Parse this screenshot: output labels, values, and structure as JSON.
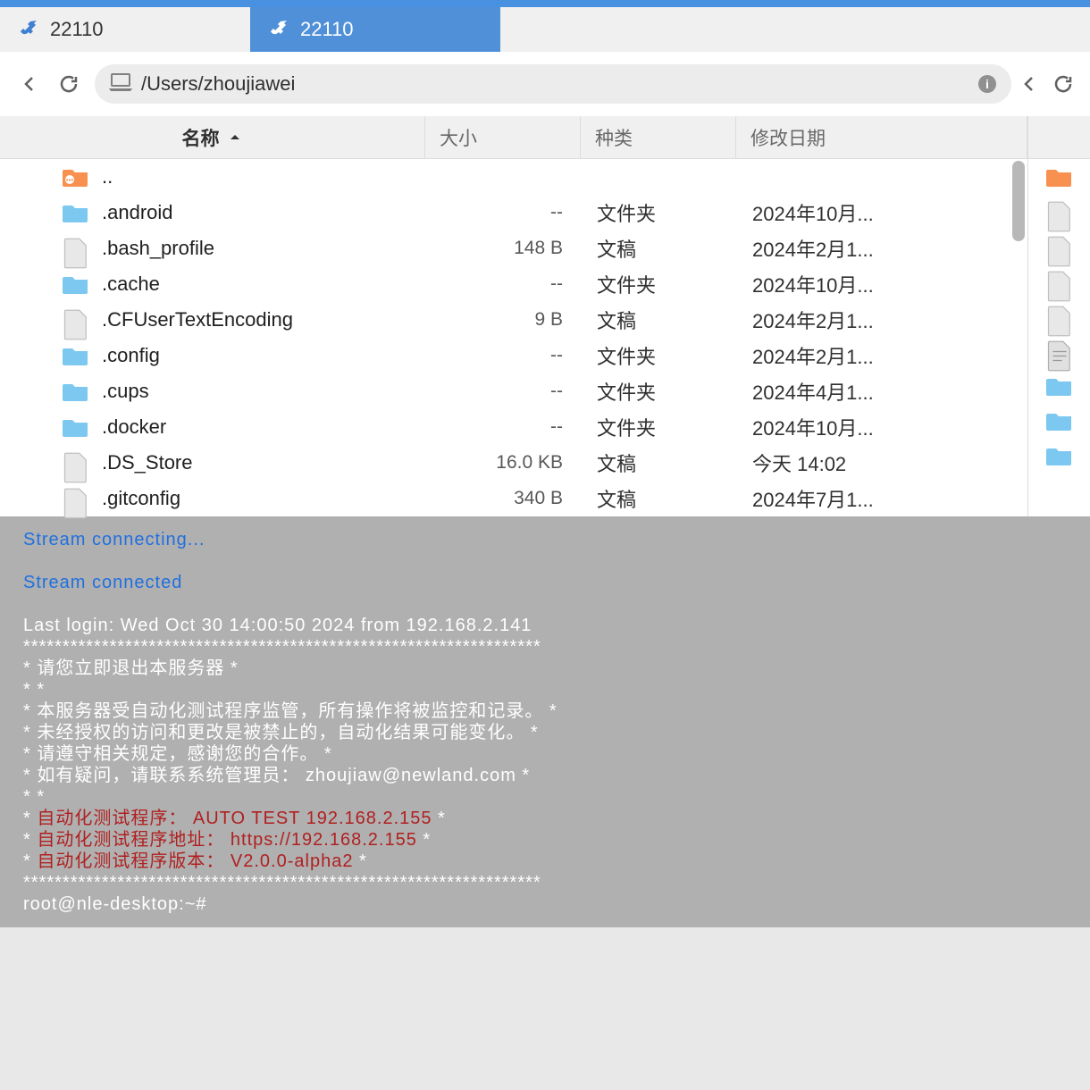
{
  "tabs": [
    {
      "label": "22110",
      "active": false
    },
    {
      "label": "22110",
      "active": true
    }
  ],
  "path": "/Users/zhoujiawei",
  "headers": {
    "name": "名称",
    "size": "大小",
    "kind": "种类",
    "date": "修改日期"
  },
  "parent_row": {
    "name": ".."
  },
  "files": [
    {
      "name": ".android",
      "size": "--",
      "kind": "文件夹",
      "date": "2024年10月...",
      "type": "folder"
    },
    {
      "name": ".bash_profile",
      "size": "148 B",
      "kind": "文稿",
      "date": "2024年2月1...",
      "type": "file"
    },
    {
      "name": ".cache",
      "size": "--",
      "kind": "文件夹",
      "date": "2024年10月...",
      "type": "folder"
    },
    {
      "name": ".CFUserTextEncoding",
      "size": "9 B",
      "kind": "文稿",
      "date": "2024年2月1...",
      "type": "file"
    },
    {
      "name": ".config",
      "size": "--",
      "kind": "文件夹",
      "date": "2024年2月1...",
      "type": "folder"
    },
    {
      "name": ".cups",
      "size": "--",
      "kind": "文件夹",
      "date": "2024年4月1...",
      "type": "folder"
    },
    {
      "name": ".docker",
      "size": "--",
      "kind": "文件夹",
      "date": "2024年10月...",
      "type": "folder"
    },
    {
      "name": ".DS_Store",
      "size": "16.0 KB",
      "kind": "文稿",
      "date": "今天 14:02",
      "type": "file"
    },
    {
      "name": ".gitconfig",
      "size": "340 B",
      "kind": "文稿",
      "date": "2024年7月1...",
      "type": "file"
    }
  ],
  "right_icons": [
    "parent",
    "file",
    "file",
    "file",
    "file",
    "doc",
    "folder",
    "folder",
    "folder"
  ],
  "terminal": {
    "connecting": "Stream connecting...",
    "connected": "Stream connected",
    "lastlogin": "Last login: Wed Oct 30 14:00:50 2024 from 192.168.2.141",
    "bar": "******************************************************************",
    "l1": "*                     请您立即退出本服务器                       *",
    "l2": "*                                                                *",
    "l3": "*   本服务器受自动化测试程序监管，所有操作将被监控和记录。       *",
    "l4": "*   未经授权的访问和更改是被禁止的，自动化结果可能变化。         *",
    "l5": "*   请遵守相关规定，感谢您的合作。                               *",
    "l6": "*   如有疑问，请联系系统管理员： zhoujiaw@newland.com            *",
    "l7": "*                                                                *",
    "r1a": "*   ",
    "r1b": "自动化测试程序：        AUTO TEST 192.168.2.155",
    "r1c": "              *",
    "r2a": "*   ",
    "r2b": "自动化测试程序地址：    https://192.168.2.155",
    "r2c": "                *",
    "r3a": "*   ",
    "r3b": "自动化测试程序版本：    V2.0.0-alpha2",
    "r3c": "                        *",
    "prompt": "root@nle-desktop:~#"
  }
}
